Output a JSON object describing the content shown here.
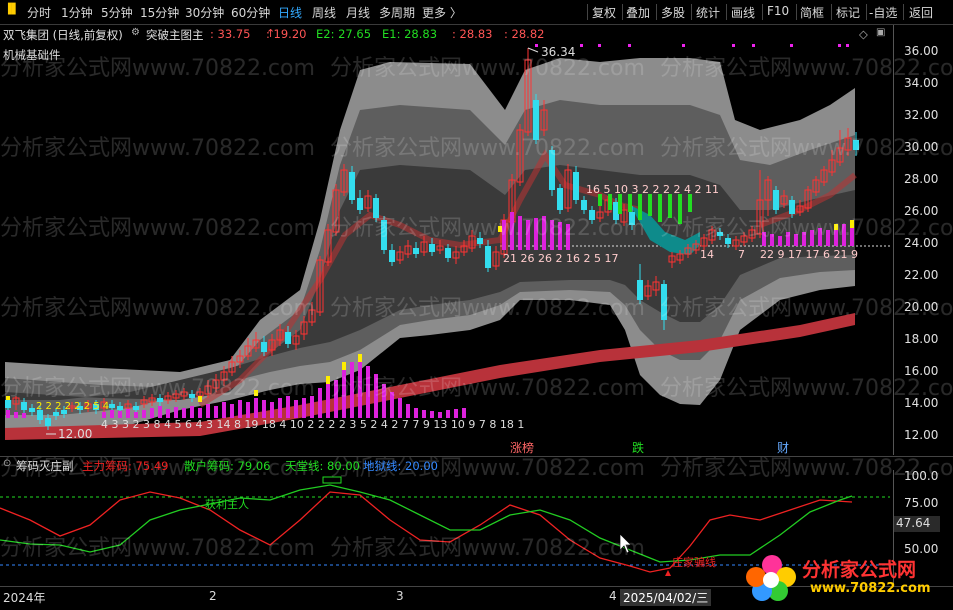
{
  "toolbar": {
    "left_items": [
      "分时",
      "1分钟",
      "5分钟",
      "15分钟",
      "30分钟",
      "60分钟",
      "日线",
      "周线",
      "月线",
      "多周期",
      "更多 〉"
    ],
    "active": "日线",
    "right_items": [
      "复权",
      "叠加",
      "多股",
      "统计",
      "画线",
      "F10",
      "简框",
      "标记",
      "-自选",
      "返回"
    ]
  },
  "info_bar": {
    "stock": "双飞集团 (日线,前复权)",
    "indicator": "突破主图主",
    "v1": ": 33.75",
    "v2": ": 19.20",
    "e2": "E2: 27.65",
    "e1": "E1: 28.83",
    "v5": ": 28.83",
    "v6": ": 28.82"
  },
  "sector_label": "机械基础件",
  "price_axis": [
    "36.00",
    "34.00",
    "32.00",
    "30.00",
    "28.00",
    "26.00",
    "24.00",
    "22.00",
    "20.00",
    "18.00",
    "16.00",
    "14.00",
    "12.00"
  ],
  "annotations": {
    "high": "36.34",
    "low": "12.00",
    "chip_text_left": "4 3 3 2 3 8 4 5 6 4 3 14 8 19 18 4 10 2 2 2 2 3 5 2 4 2 7 7 9 13 10 9 7 8 18 1",
    "chip_text_mid": "21 26 26 2 16 2 5 17",
    "chip_text_green": "16 5 10 3 2 2 2 2 4 2 11",
    "chip_text_right": "22 9 17 17 6 21 9",
    "early_text": "2 2 2 2 2 2 5 4",
    "signal_1": "14",
    "signal_2": "7",
    "marker_up": "涨榜",
    "marker_down": "跌",
    "marker_cai": "财"
  },
  "sub_indicator": {
    "name": "筹码灭庄副",
    "main_label": "主力筹码: 75.49",
    "retail_label": "散户筹码: 79.06",
    "heaven_label": "天堂线: 80.00",
    "hell_label": "地狱线: 20.00",
    "axis": [
      "100.0",
      "75.00",
      "50.00"
    ],
    "current": "47.64",
    "text_profit": "获利主人",
    "text_trap": "庄家骗线"
  },
  "date_axis": {
    "year": "2024年",
    "m2": "2",
    "m3": "3",
    "m4": "4",
    "cursor_date": "2025/04/02/三"
  },
  "watermark": {
    "text": "分析家公式网www.70822.com",
    "logo_text": "分析家公式网",
    "logo_url": "www.70822.com"
  },
  "colors": {
    "up": "#ff3333",
    "down": "#33ddee",
    "magenta": "#dd22dd",
    "yellow": "#ffee00",
    "green": "#22dd22",
    "blue": "#3388ff"
  }
}
